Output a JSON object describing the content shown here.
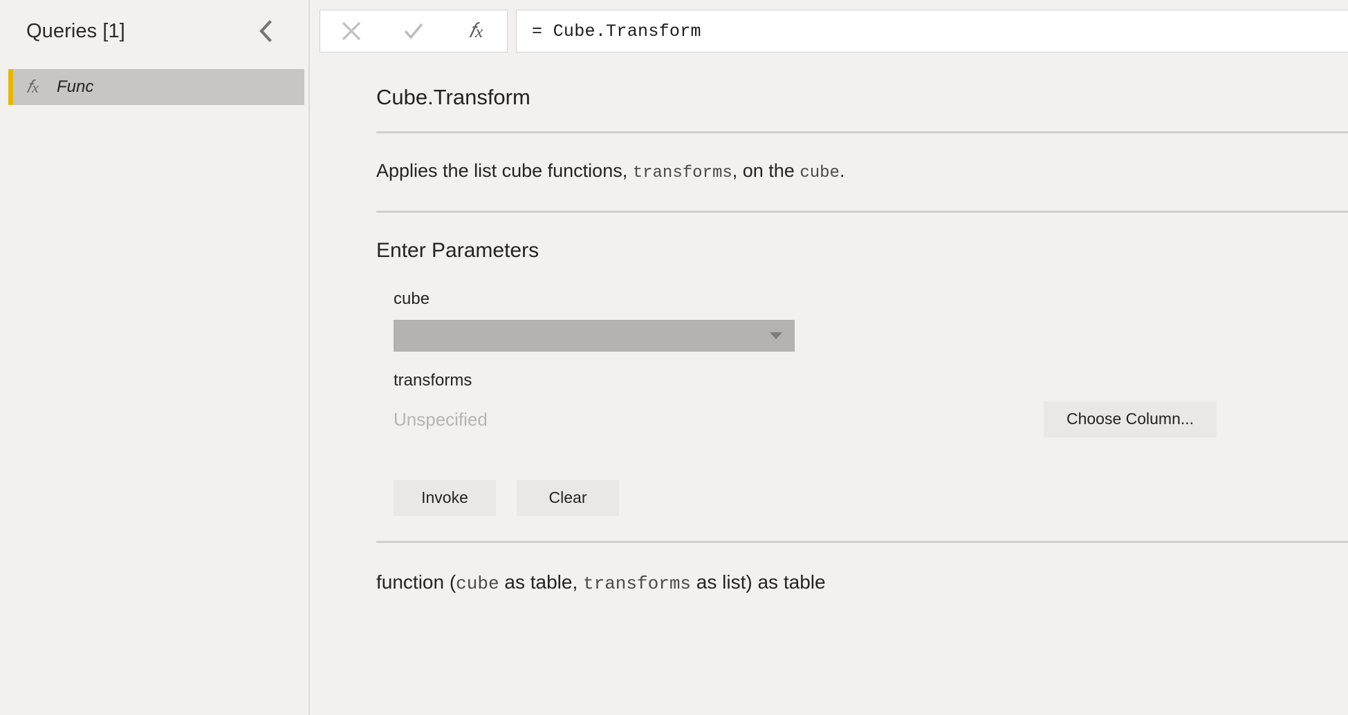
{
  "sidebar": {
    "title": "Queries [1]",
    "collapse_icon": "chevron-left-icon",
    "items": [
      {
        "icon": "fx-icon",
        "label": "Func",
        "selected": true,
        "accent_color": "#e6b700"
      }
    ]
  },
  "formula_bar": {
    "cancel_icon": "close-icon",
    "accept_icon": "check-icon",
    "fx_icon": "fx-icon",
    "value": "= Cube.Transform"
  },
  "function_doc": {
    "title": "Cube.Transform",
    "description": {
      "part1": "Applies the list cube functions, ",
      "code1": "transforms",
      "part2": ", on the ",
      "code2": "cube",
      "part3": "."
    },
    "parameters_heading": "Enter Parameters",
    "parameters": [
      {
        "name": "cube",
        "control": "dropdown",
        "value": "",
        "dropdown_icon": "chevron-down-icon"
      },
      {
        "name": "transforms",
        "control": "placeholder-with-button",
        "placeholder": "Unspecified",
        "button_label": "Choose Column..."
      }
    ],
    "actions": {
      "invoke_label": "Invoke",
      "clear_label": "Clear"
    },
    "signature": {
      "kw_function": "function (",
      "param1": "cube",
      "kw1": " as table, ",
      "param2": "transforms",
      "kw2": " as list) as table"
    }
  },
  "colors": {
    "background": "#f2f1ef",
    "selected_row": "#c8c6c4",
    "accent": "#e6b700",
    "divider": "#d0cfcc",
    "button_face": "#e9e8e6",
    "disabled_field": "#b4b3b1"
  }
}
